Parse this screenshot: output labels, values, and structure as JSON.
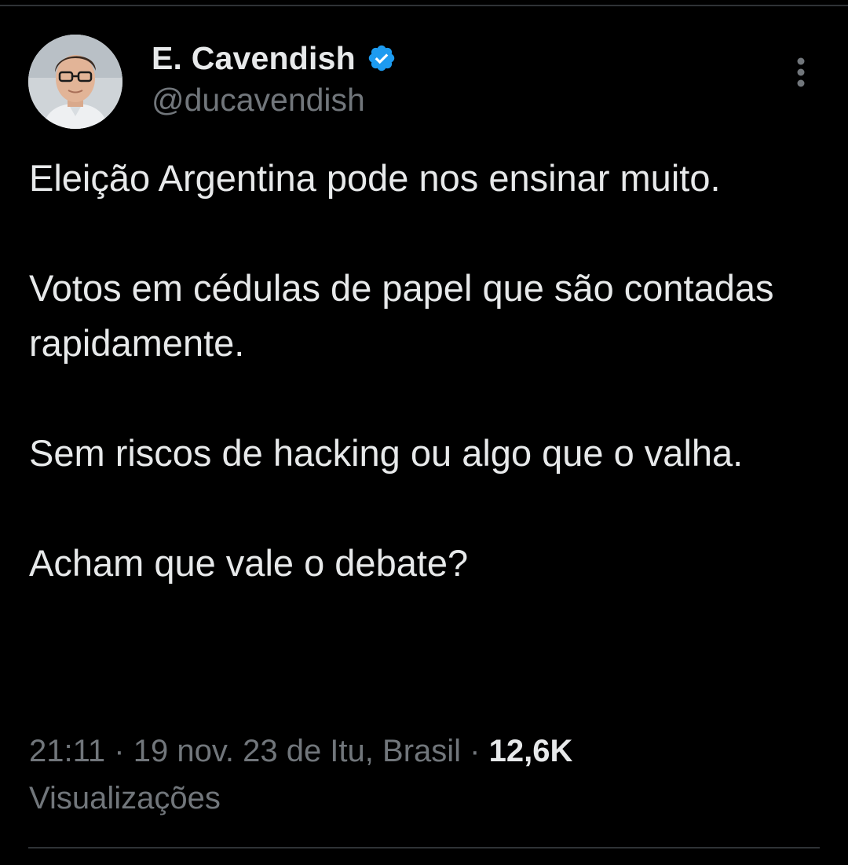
{
  "tweet": {
    "author": {
      "display_name": "E. Cavendish",
      "handle": "@ducavendish",
      "verified": true,
      "verified_icon": "verified-badge-icon",
      "avatar": "profile-photo"
    },
    "more_icon": "more-vertical-icon",
    "paragraphs": [
      "Eleição Argentina pode nos ensinar muito.",
      "Votos em cédulas de papel que são contadas rapidamente.",
      "Sem riscos de hacking ou algo que o valha.",
      "Acham que vale o debate?"
    ],
    "meta": {
      "time": "21:11",
      "separator": "·",
      "date": "19 nov. 23",
      "location": "de Itu, Brasil",
      "views_count": "12,6K",
      "views_label": "Visualizações"
    }
  },
  "colors": {
    "background": "#000000",
    "primary_text": "#e7e9ea",
    "secondary_text": "#71767b",
    "verified_blue": "#1d9bf0",
    "divider": "#2f3336"
  }
}
